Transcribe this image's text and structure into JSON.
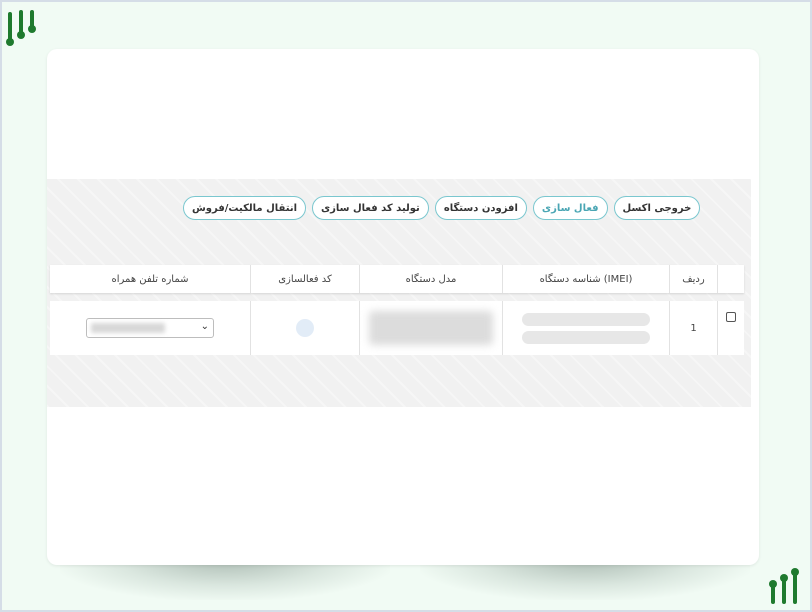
{
  "toolbar": {
    "transfer_label": "انتقال مالکیت/فروش",
    "generate_code_label": "تولید کد فعال سازی",
    "add_device_label": "افزودن دستگاه",
    "activate_label": "فعال سازی",
    "excel_label": "خروجی اکسل"
  },
  "table": {
    "headers": {
      "index": "ردیف",
      "imei": "شناسه دستگاه (IMEI)",
      "model": "مدل دستگاه",
      "activation_code": "کد فعالسازی",
      "phone": "شماره تلفن همراه"
    },
    "rows": [
      {
        "index": "1"
      }
    ]
  },
  "colors": {
    "accent": "#4aa6b4",
    "button_border": "#7ac7cf",
    "logo_green": "#1f7a2e",
    "page_bg": "#f1fbf4"
  },
  "icons": {
    "logo": "brand-logo-icon",
    "select_arrow": "chevron-down-icon",
    "row_select": "row-select-radio"
  }
}
